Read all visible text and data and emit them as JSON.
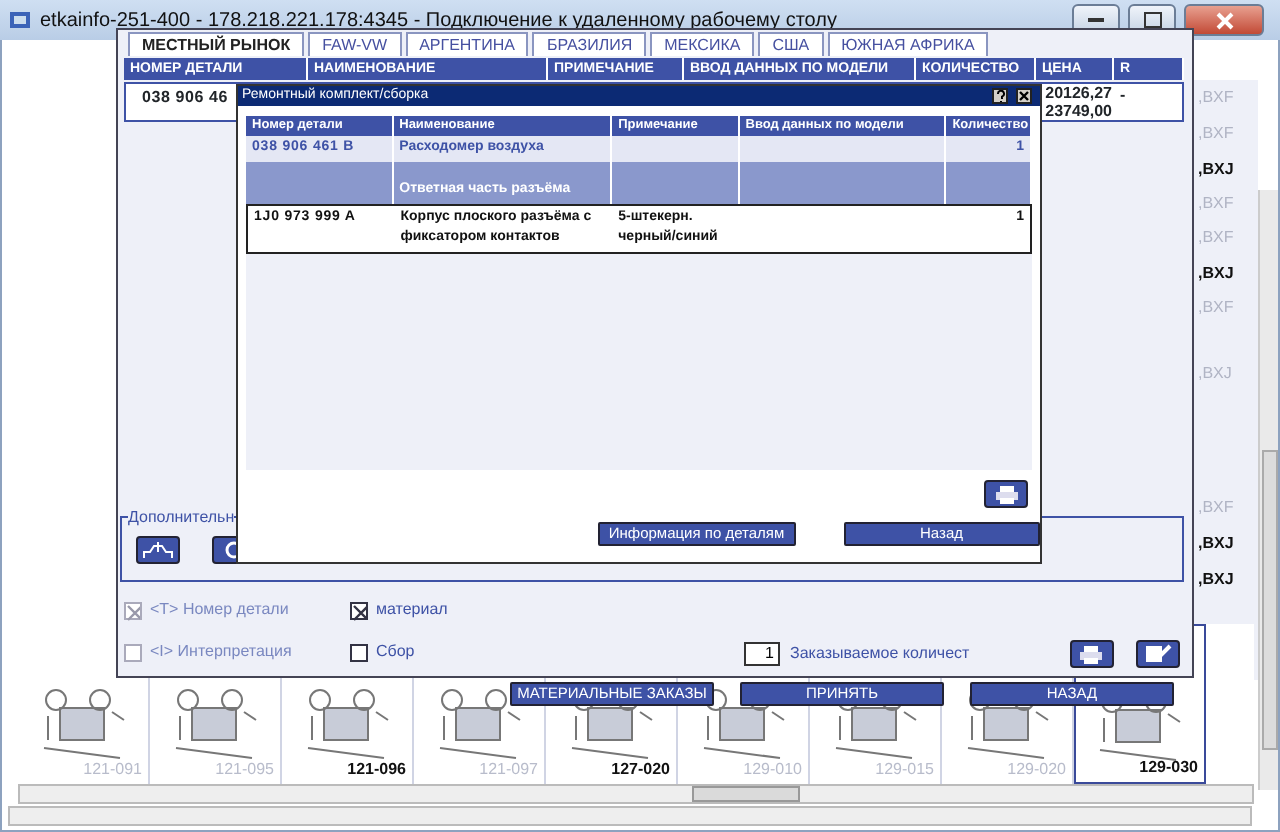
{
  "window": {
    "title": "etkainfo-251-400 - 178.218.221.178:4345 - Подключение к удаленному рабочему столу"
  },
  "main_dialog": {
    "tabs": [
      {
        "label": "МЕСТНЫЙ РЫНОК",
        "selected": true
      },
      {
        "label": "FAW-VW",
        "selected": false
      },
      {
        "label": "АРГЕНТИНА",
        "selected": false
      },
      {
        "label": "БРАЗИЛИЯ",
        "selected": false
      },
      {
        "label": "МЕКСИКА",
        "selected": false
      },
      {
        "label": "США",
        "selected": false
      },
      {
        "label": "ЮЖНАЯ АФРИКА",
        "selected": false
      }
    ],
    "columns": [
      "НОМЕР ДЕТАЛИ",
      "НАИМЕНОВАНИЕ",
      "ПРИМЕЧАНИЕ",
      "ВВОД ДАННЫХ ПО МОДЕЛИ",
      "КОЛИЧЕСТВО",
      "ЦЕНА",
      "R"
    ],
    "row": {
      "part_number": "038 906 46",
      "prices": [
        "20126,27",
        "23749,00"
      ],
      "r": "-"
    },
    "extra_section": {
      "legend": "Дополнительн"
    },
    "options": [
      {
        "label": "<T> Номер детали",
        "checked": true,
        "disabled": true
      },
      {
        "label": "материал",
        "checked": true,
        "disabled": false
      },
      {
        "label": "<I> Интерпретация",
        "checked": false,
        "disabled": true
      },
      {
        "label": "Сбор",
        "checked": false,
        "disabled": false
      }
    ],
    "quantity": {
      "value": "1",
      "label": "Заказываемое количест"
    },
    "buttons": [
      "МАТЕРИАЛЬНЫЕ ЗАКАЗЫ",
      "ПРИНЯТЬ",
      "НАЗАД"
    ]
  },
  "modal": {
    "title": "Ремонтный комплект/сборка",
    "columns": [
      "Номер детали",
      "Наименование",
      "Примечание",
      "Ввод данных по модели",
      "Количество"
    ],
    "rows": [
      {
        "kind": "part",
        "selected": false,
        "part_number": "038 906 461 B",
        "name": "Расходомер воздуха",
        "quantity": "1"
      },
      {
        "kind": "group",
        "selected": false,
        "name": "Ответная часть разъёма"
      },
      {
        "kind": "part",
        "selected": true,
        "part_number": "1J0 973 999 A",
        "name": "Корпус плоского разъёма с фиксатором контактов",
        "note": "5-штекерн. черный/синий",
        "quantity": "1"
      }
    ],
    "buttons": [
      "Информация по деталям",
      "Назад"
    ]
  },
  "model_codes": [
    {
      "text": ",BXF",
      "bold": false
    },
    {
      "text": ",BXF",
      "bold": false
    },
    {
      "text": ",BXJ",
      "bold": true
    },
    {
      "text": ",BXF",
      "bold": false
    },
    {
      "text": ",BXF",
      "bold": false
    },
    {
      "text": ",BXJ",
      "bold": true
    },
    {
      "text": ",BXF",
      "bold": false
    },
    {
      "text": ",BXJ",
      "bold": false
    },
    {
      "text": ",BXF",
      "bold": false
    },
    {
      "text": ",BXJ",
      "bold": true
    },
    {
      "text": ",BXJ",
      "bold": true
    }
  ],
  "thumbnails": [
    {
      "label": "121-091",
      "bold": false,
      "selected": false
    },
    {
      "label": "121-095",
      "bold": false,
      "selected": false
    },
    {
      "label": "121-096",
      "bold": true,
      "selected": false
    },
    {
      "label": "121-097",
      "bold": false,
      "selected": false
    },
    {
      "label": "127-020",
      "bold": true,
      "selected": false
    },
    {
      "label": "129-010",
      "bold": false,
      "selected": false
    },
    {
      "label": "129-015",
      "bold": false,
      "selected": false
    },
    {
      "label": "129-020",
      "bold": false,
      "selected": false
    },
    {
      "label": "129-030",
      "bold": true,
      "selected": true
    }
  ]
}
